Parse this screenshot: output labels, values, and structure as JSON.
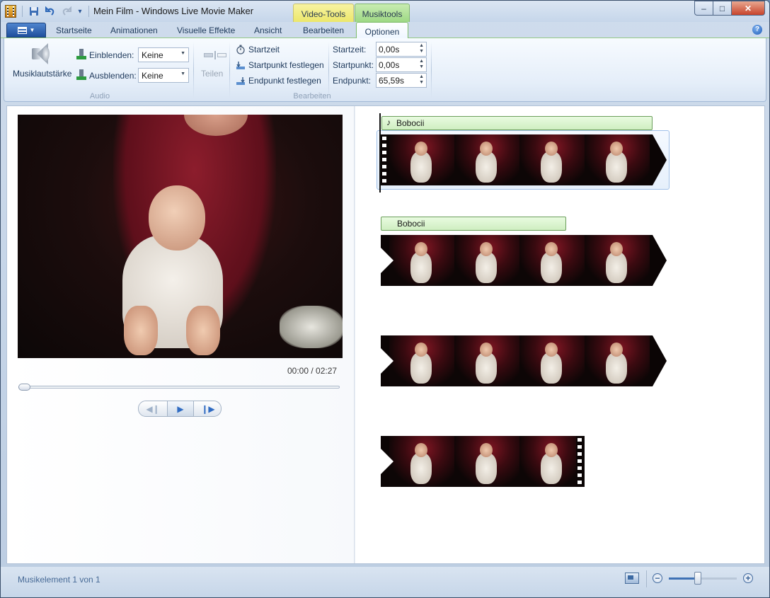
{
  "window": {
    "title": "Mein Film - Windows Live Movie Maker",
    "context_tabs": {
      "video": "Video-Tools",
      "music": "Musiktools"
    },
    "controls": {
      "minimize": "–",
      "maximize": "□",
      "close": "✕"
    }
  },
  "quick_access": {
    "icons": [
      "save-icon",
      "undo-icon",
      "redo-icon",
      "customize-icon"
    ],
    "more": "▾"
  },
  "tabs": {
    "items": [
      "Startseite",
      "Animationen",
      "Visuelle Effekte",
      "Ansicht",
      "Bearbeiten"
    ],
    "active": "Optionen"
  },
  "ribbon": {
    "audio": {
      "volume_label": "Musiklautstärke",
      "fade_in_label": "Einblenden:",
      "fade_in_value": "Keine",
      "fade_out_label": "Ausblenden:",
      "fade_out_value": "Keine",
      "group_label": "Audio"
    },
    "edit": {
      "split_label": "Teilen",
      "start_time_button": "Startzeit",
      "set_start_point": "Startpunkt festlegen",
      "set_end_point": "Endpunkt festlegen",
      "start_time_label": "Startzeit:",
      "start_time_value": "0,00s",
      "start_point_label": "Startpunkt:",
      "start_point_value": "0,00s",
      "end_point_label": "Endpunkt:",
      "end_point_value": "65,59s",
      "group_label": "Bearbeiten"
    }
  },
  "preview": {
    "time": "00:00 / 02:27",
    "seek_fraction": 0.0,
    "transport": {
      "prev": "◀❙",
      "play": "▶",
      "next": "❙▶"
    }
  },
  "storyboard": {
    "music_items": [
      {
        "title": "Bobocii",
        "icon": "music-note-icon"
      },
      {
        "title": "Bobocii"
      }
    ],
    "music_note": "♪"
  },
  "status": {
    "text": "Musikelement 1 von 1",
    "zoom_minus": "−",
    "zoom_plus": "+",
    "zoom_level_fraction": 0.42
  },
  "help": "?"
}
